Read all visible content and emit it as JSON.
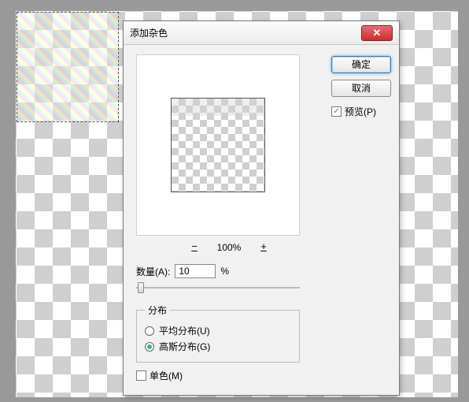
{
  "dialog": {
    "title": "添加杂色",
    "ok_label": "确定",
    "cancel_label": "取消",
    "preview_label": "预览(P)",
    "preview_checked": true,
    "zoom": {
      "minus": "−",
      "plus": "+",
      "value": "100%"
    },
    "amount": {
      "label": "数量(A):",
      "value": "10",
      "suffix": "%"
    },
    "distribution": {
      "legend": "分布",
      "uniform_label": "平均分布(U)",
      "gaussian_label": "高斯分布(G)",
      "selected": "gaussian"
    },
    "mono": {
      "label": "单色(M)",
      "checked": false
    },
    "close_glyph": "✕"
  }
}
